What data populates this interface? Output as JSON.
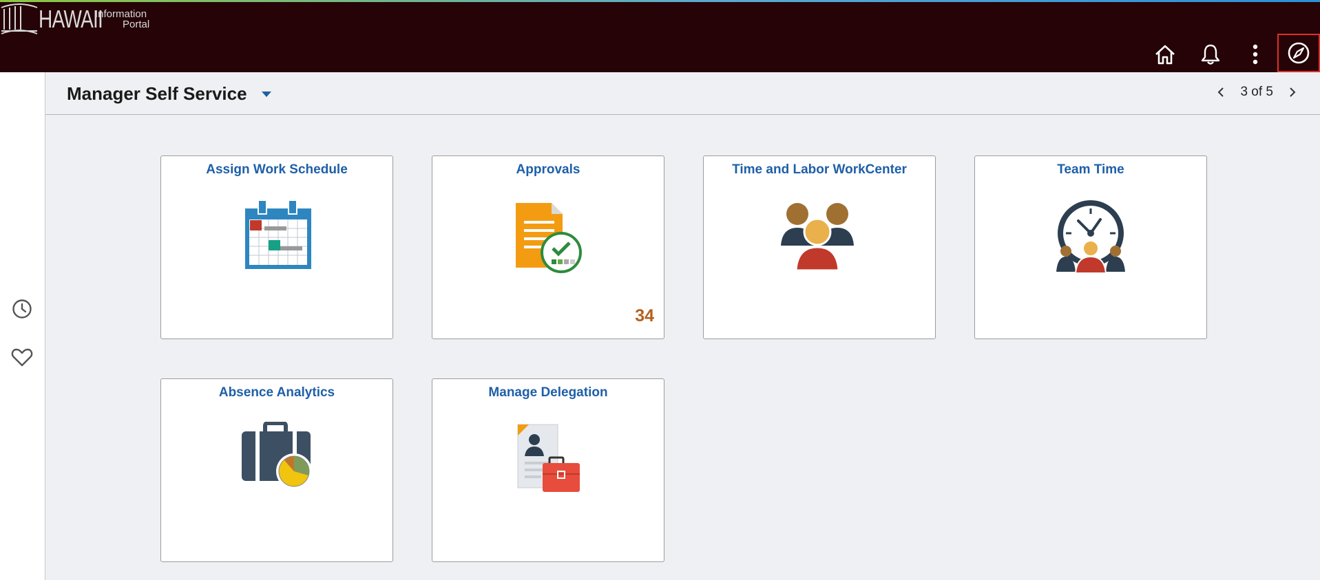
{
  "header": {
    "logo_word": "HAWAII",
    "logo_sub_line1": "Information",
    "logo_sub_line2": "Portal",
    "buttons": [
      "home-icon",
      "bell-icon",
      "more-vertical-icon",
      "compass-icon"
    ]
  },
  "sidebar": {
    "icons": [
      "clock-icon",
      "heart-icon"
    ]
  },
  "pagebar": {
    "title": "Manager Self Service",
    "pager_text": "3 of 5"
  },
  "tiles": [
    {
      "title": "Assign Work Schedule",
      "icon": "calendar-icon"
    },
    {
      "title": "Approvals",
      "icon": "approved-document-icon",
      "count": "34"
    },
    {
      "title": "Time and Labor WorkCenter",
      "icon": "team-people-icon"
    },
    {
      "title": "Team Time",
      "icon": "clock-team-icon"
    },
    {
      "title": "Absence Analytics",
      "icon": "briefcase-chart-icon"
    },
    {
      "title": "Manage Delegation",
      "icon": "document-briefcase-icon"
    }
  ],
  "colors": {
    "header_bg": "#250307",
    "tile_title": "#1e5fa8",
    "count": "#b4601e",
    "highlight": "#e0302b"
  }
}
